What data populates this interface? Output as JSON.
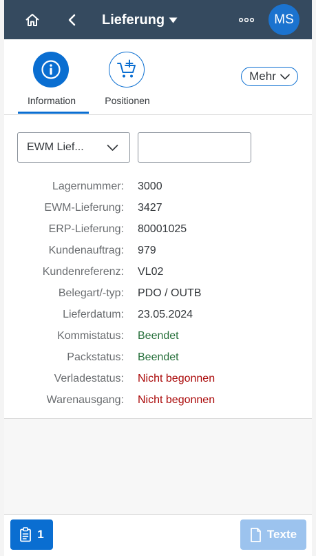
{
  "header": {
    "title": "Lieferung",
    "avatar_initials": "MS",
    "background_color": "#354a5f",
    "icons": {
      "home": "home-icon",
      "back": "back-icon",
      "title_menu": "caret-down-icon",
      "overflow": "overflow-icon"
    }
  },
  "tabs": [
    {
      "label": "Information",
      "icon": "info-icon",
      "selected": true
    },
    {
      "label": "Positionen",
      "icon": "cart-add-icon",
      "selected": false
    }
  ],
  "more_button": {
    "label": "Mehr"
  },
  "filter": {
    "select_value": "EWM Lief...",
    "input_value": "",
    "input_placeholder": ""
  },
  "fields": [
    {
      "label": "Lagernummer:",
      "value": "3000",
      "status": "neutral"
    },
    {
      "label": "EWM-Lieferung:",
      "value": "3427",
      "status": "neutral"
    },
    {
      "label": "ERP-Lieferung:",
      "value": "80001025",
      "status": "neutral"
    },
    {
      "label": "Kundenauftrag:",
      "value": "979",
      "status": "neutral"
    },
    {
      "label": "Kundenreferenz:",
      "value": "VL02",
      "status": "neutral"
    },
    {
      "label": "Belegart/-typ:",
      "value": "PDO / OUTB",
      "status": "neutral"
    },
    {
      "label": "Lieferdatum:",
      "value": "23.05.2024",
      "status": "neutral"
    },
    {
      "label": "Kommistatus:",
      "value": "Beendet",
      "status": "positive"
    },
    {
      "label": "Packstatus:",
      "value": "Beendet",
      "status": "positive"
    },
    {
      "label": "Verladestatus:",
      "value": "Nicht begonnen",
      "status": "negative"
    },
    {
      "label": "Warenausgang:",
      "value": "Nicht begonnen",
      "status": "negative"
    }
  ],
  "colors": {
    "accent": "#0a6ed1",
    "positive": "#256f3a",
    "negative": "#aa0808",
    "neutral": "#32363a"
  },
  "footer": {
    "count_button": {
      "label": "1",
      "icon": "clipboard-icon"
    },
    "texte_button": {
      "label": "Texte",
      "icon": "document-icon",
      "enabled": false
    }
  }
}
